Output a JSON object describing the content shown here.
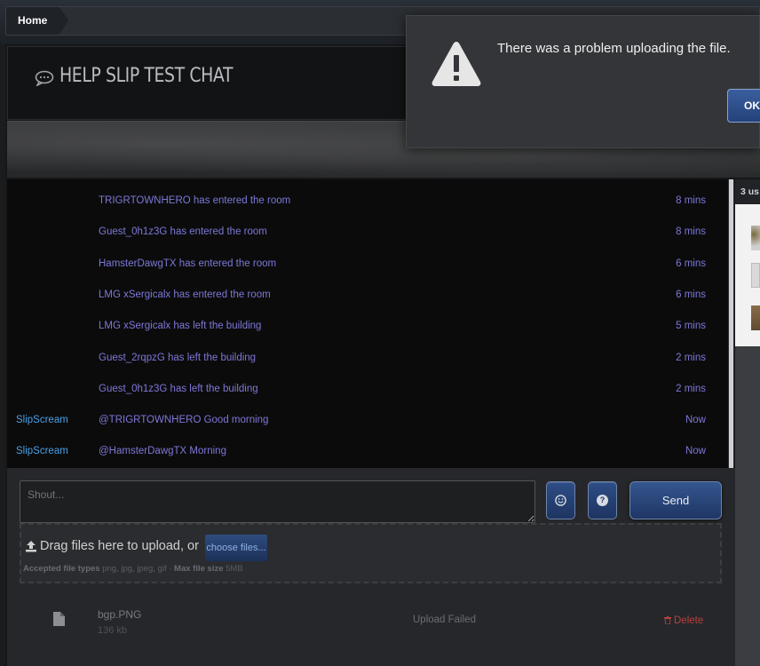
{
  "breadcrumb": {
    "home": "Home"
  },
  "chat": {
    "title": "HELP SLIP TEST CHAT"
  },
  "messages": [
    {
      "user": "",
      "text": "TRIGRTOWNHERO has entered the room",
      "time": "8 mins"
    },
    {
      "user": "",
      "text": "Guest_0h1z3G has entered the room",
      "time": "8 mins"
    },
    {
      "user": "",
      "text": "HamsterDawgTX has entered the room",
      "time": "6 mins"
    },
    {
      "user": "",
      "text": "LMG xSergicalx has entered the room",
      "time": "6 mins"
    },
    {
      "user": "",
      "text": "LMG xSergicalx has left the building",
      "time": "5 mins"
    },
    {
      "user": "",
      "text": "Guest_2rqpzG has left the building",
      "time": "2 mins"
    },
    {
      "user": "",
      "text": "Guest_0h1z3G has left the building",
      "time": "2 mins"
    },
    {
      "user": "SlipScream",
      "text": "@TRIGRTOWNHERO Good morning",
      "time": "Now"
    },
    {
      "user": "SlipScream",
      "text": "@HamsterDawgTX Morning",
      "time": "Now"
    }
  ],
  "sidebar": {
    "users_heading": "3 us"
  },
  "compose": {
    "placeholder": "Shout...",
    "send_label": "Send",
    "emoji_icon": "smiley-icon",
    "help_icon": "question-icon"
  },
  "upload": {
    "drop_text": "Drag files here to upload, or",
    "choose_label": "choose files...",
    "accepted_label": "Accepted file types",
    "accepted_types": "png, jpg, jpeg, gif",
    "separator": "·",
    "max_label": "Max file size",
    "max_value": "5MB"
  },
  "file": {
    "name": "bgp.PNG",
    "size": "136 kb",
    "status": "Upload Failed",
    "delete_label": "Delete"
  },
  "dialog": {
    "message": "There was a problem uploading the file.",
    "ok_label": "OK"
  },
  "colors": {
    "accent": "#2e4e86",
    "system_text": "#7d78d6",
    "username": "#4aa0e6",
    "danger": "#b8413e"
  }
}
